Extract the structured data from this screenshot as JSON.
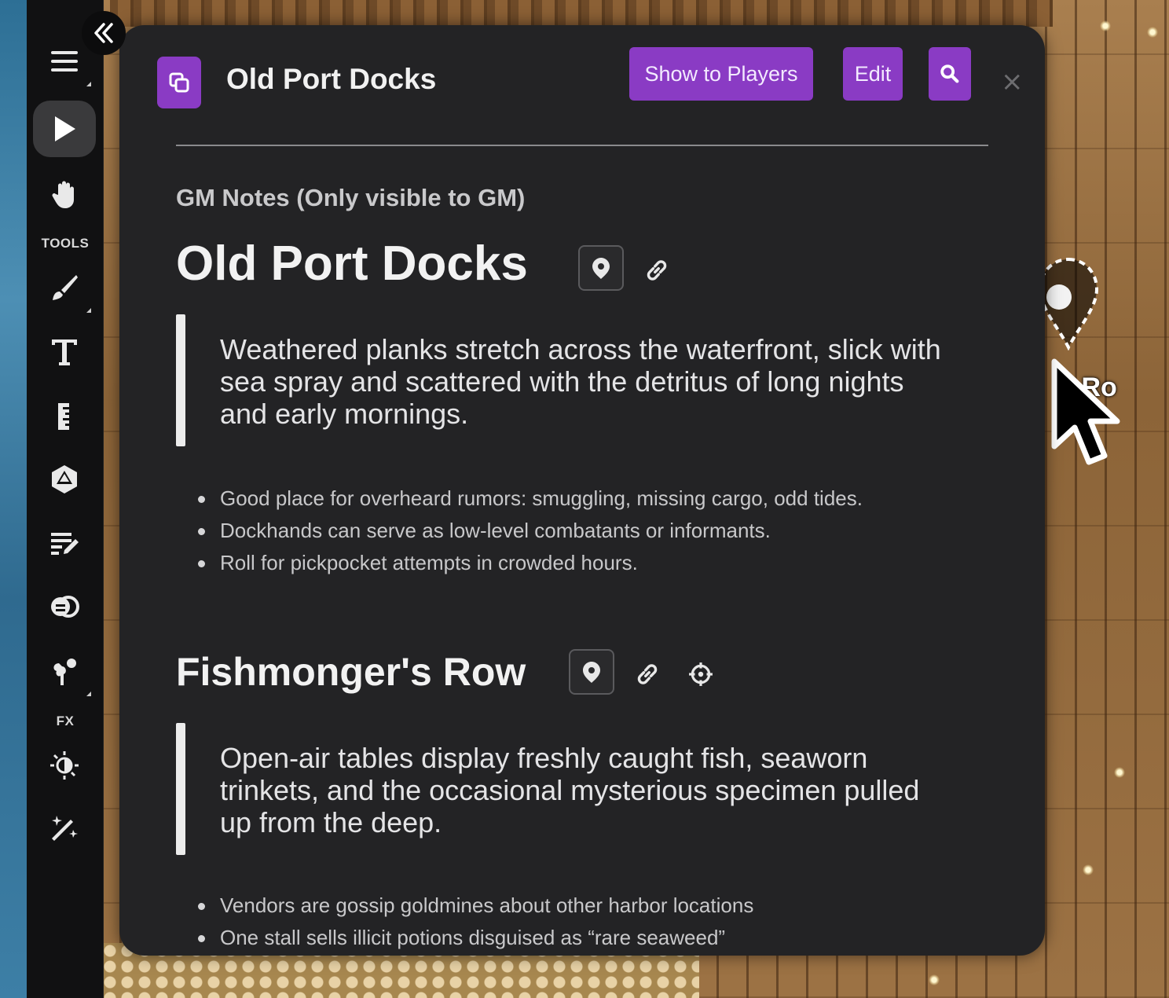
{
  "toolbar": {
    "tools_label": "TOOLS",
    "fx_label": "FX",
    "items": [
      {
        "icon": "menu-icon"
      },
      {
        "icon": "pointer-icon",
        "active": true
      },
      {
        "icon": "hand-icon"
      },
      {
        "icon": "brush-icon"
      },
      {
        "icon": "text-icon"
      },
      {
        "icon": "ruler-icon"
      },
      {
        "icon": "dice-icon"
      },
      {
        "icon": "notes-edit-icon"
      },
      {
        "icon": "fog-icon"
      },
      {
        "icon": "fx-particles-icon"
      },
      {
        "icon": "lighting-icon"
      },
      {
        "icon": "magic-wand-icon"
      }
    ]
  },
  "map": {
    "label_fragment": "'s Ro"
  },
  "panel": {
    "header_title": "Old Port Docks",
    "show_to_players_label": "Show to Players",
    "edit_label": "Edit",
    "close_glyph": "×",
    "gm_notes_label": "GM Notes (Only visible to GM)",
    "sections": [
      {
        "heading": "Old Port Docks",
        "description": "Weathered planks stretch across the waterfront, slick with sea spray and scattered with the detritus of long nights and early mornings.",
        "bullets": [
          "Good place for overheard rumors: smuggling, missing cargo, odd tides.",
          "Dockhands can serve as low-level combatants or informants.",
          "Roll for pickpocket attempts in crowded hours."
        ]
      },
      {
        "heading": "Fishmonger's Row",
        "description": "Open-air tables display freshly caught fish, seaworn trinkets, and the occasional mysterious specimen pulled up from the deep.",
        "bullets": [
          "Vendors are gossip goldmines about other harbor locations",
          "One stall sells illicit potions disguised as “rare seaweed”"
        ]
      }
    ]
  },
  "colors": {
    "accent": "#8a3bc4",
    "panel_bg": "#232325",
    "toolbar_bg": "#111112"
  }
}
